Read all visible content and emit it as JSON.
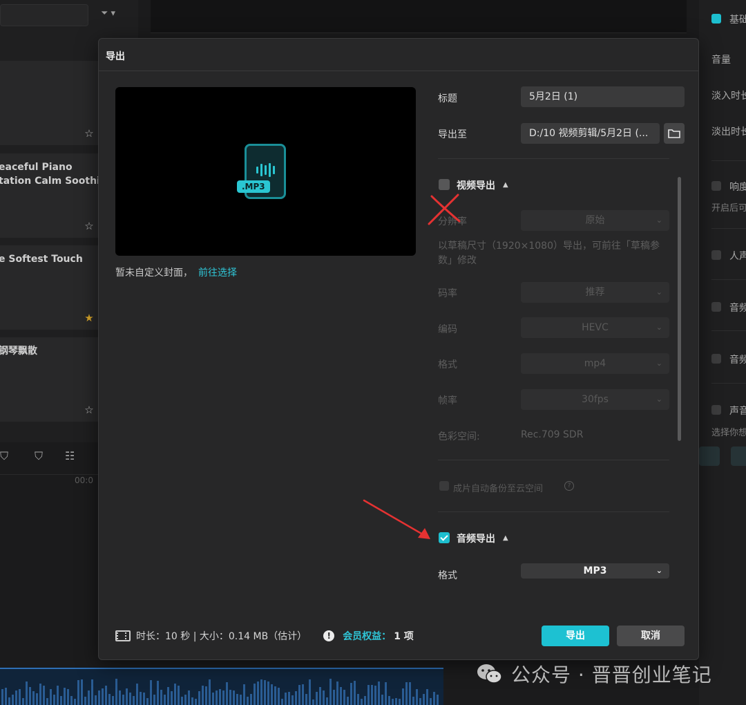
{
  "background": {
    "filter_label": "▾",
    "tracks": [
      {
        "title": "",
        "star": "☆"
      },
      {
        "title": "eaceful Piano\ntation Calm Soothin",
        "star": "☆"
      },
      {
        "title": "e Softest Touch",
        "star": "★"
      },
      {
        "title": "钢琴飘散",
        "star": "☆"
      }
    ],
    "timeline_time": "00:0",
    "right_panel": [
      {
        "label": "基础",
        "checked": true
      },
      {
        "label": "音量"
      },
      {
        "label": "淡入时长"
      },
      {
        "label": "淡出时长"
      },
      {
        "label": "响度",
        "checked": false
      },
      {
        "label": "开启后可"
      },
      {
        "label": "人声",
        "checked": false
      },
      {
        "label": "音频",
        "checked": false
      },
      {
        "label": "音频",
        "checked": false
      },
      {
        "label": "声音",
        "checked": false
      },
      {
        "label": "选择你想"
      }
    ]
  },
  "dialog": {
    "title": "导出",
    "cover": {
      "badge": ".MP3",
      "note": "暂未自定义封面，",
      "link": "前往选择"
    },
    "fields": {
      "title_label": "标题",
      "title_value": "5月2日 (1)",
      "export_to_label": "导出至",
      "export_to_value": "D:/10 视频剪辑/5月2日 (..."
    },
    "video_export": {
      "label": "视频导出",
      "checked": false,
      "resolution_label": "分辨率",
      "resolution_value": "原始",
      "hint": "以草稿尺寸（1920×1080）导出，可前往「草稿参数」修改",
      "bitrate_label": "码率",
      "bitrate_value": "推荐",
      "codec_label": "编码",
      "codec_value": "HEVC",
      "format_label": "格式",
      "format_value": "mp4",
      "fps_label": "帧率",
      "fps_value": "30fps",
      "colorspace_label": "色彩空间:",
      "colorspace_value": "Rec.709 SDR",
      "cloud_backup_label": "成片自动备份至云空间"
    },
    "audio_export": {
      "label": "音频导出",
      "checked": true,
      "format_label": "格式",
      "format_value": "MP3"
    },
    "footer": {
      "info": "时长：10 秒 | 大小：0.14 MB（估计）",
      "member_label": "会员权益：",
      "member_value": "1 项",
      "export_button": "导出",
      "cancel_button": "取消"
    }
  },
  "watermark": "公众号 · 晋晋创业笔记",
  "colors": {
    "accent": "#1dc1d2",
    "link": "#2fc5d6",
    "annotation_red": "#e53232"
  },
  "icons": {
    "folder": "folder-icon",
    "film": "film-icon",
    "warning": "exclamation-icon",
    "help": "help-icon",
    "star": "star-icon"
  }
}
